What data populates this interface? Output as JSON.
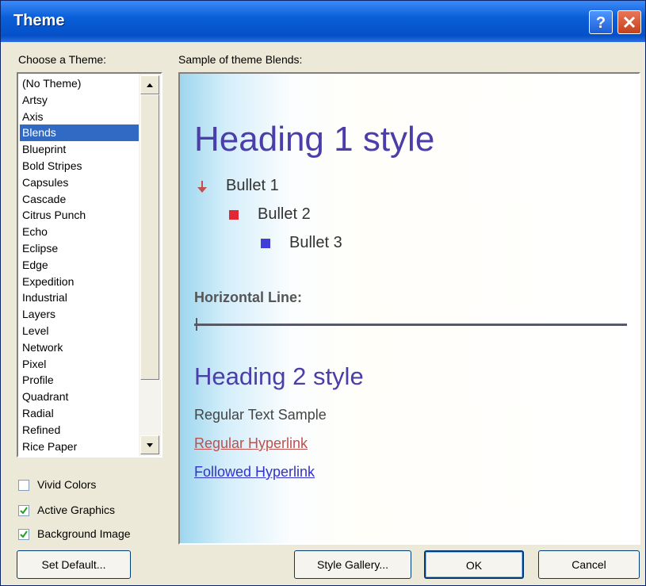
{
  "window": {
    "title": "Theme"
  },
  "labels": {
    "choose_theme": "Choose a Theme:",
    "sample_prefix": "Sample of theme Blends:"
  },
  "themes": [
    "(No Theme)",
    "Artsy",
    "Axis",
    "Blends",
    "Blueprint",
    "Bold Stripes",
    "Capsules",
    "Cascade",
    "Citrus Punch",
    "Echo",
    "Eclipse",
    "Edge",
    "Expedition",
    "Industrial",
    "Layers",
    "Level",
    "Network",
    "Pixel",
    "Profile",
    "Quadrant",
    "Radial",
    "Refined",
    "Rice Paper"
  ],
  "selected_theme": "Blends",
  "options": {
    "vivid_colors": {
      "label": "Vivid Colors",
      "checked": false
    },
    "active_graphics": {
      "label": "Active Graphics",
      "checked": true
    },
    "background_image": {
      "label": "Background Image",
      "checked": true
    }
  },
  "preview": {
    "heading1": "Heading 1 style",
    "bullet1": "Bullet 1",
    "bullet2": "Bullet 2",
    "bullet3": "Bullet 3",
    "hline_label": "Horizontal Line:",
    "heading2": "Heading 2 style",
    "regular_text": "Regular Text Sample",
    "hyperlink": "Regular Hyperlink",
    "followed_hyperlink": "Followed Hyperlink"
  },
  "buttons": {
    "set_default": "Set Default...",
    "style_gallery": "Style Gallery...",
    "ok": "OK",
    "cancel": "Cancel"
  },
  "icons": {
    "help": "question-mark-icon",
    "close": "close-icon",
    "scroll_up": "arrow-up-icon",
    "scroll_down": "arrow-down-icon"
  },
  "colors": {
    "titlebar": "#0a5fd8",
    "selection": "#316ac5",
    "heading": "#4c3eaa",
    "hyperlink": "#c0504d",
    "followed_hyperlink": "#3333cc"
  }
}
